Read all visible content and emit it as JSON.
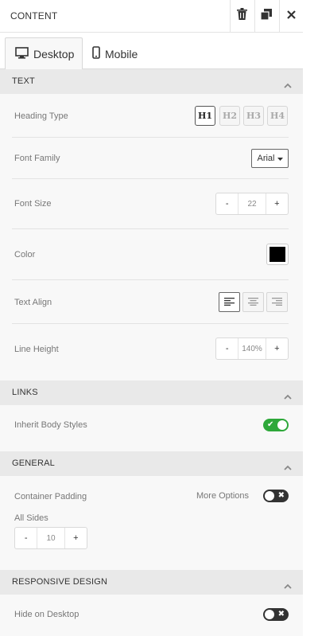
{
  "header": {
    "title": "CONTENT",
    "icons": [
      "trash-icon",
      "copy-icon",
      "close-icon"
    ]
  },
  "tabs": [
    {
      "label": "Desktop",
      "icon": "monitor-icon",
      "active": true
    },
    {
      "label": "Mobile",
      "icon": "phone-icon",
      "active": false
    }
  ],
  "sections": {
    "text": {
      "title": "TEXT",
      "heading_type": {
        "label": "Heading Type",
        "options": [
          "H1",
          "H2",
          "H3",
          "H4"
        ],
        "selected": "H1"
      },
      "font_family": {
        "label": "Font Family",
        "value": "Arial"
      },
      "font_size": {
        "label": "Font Size",
        "value": "22",
        "minus": "-",
        "plus": "+"
      },
      "color": {
        "label": "Color",
        "value": "#000000"
      },
      "text_align": {
        "label": "Text Align",
        "options": [
          "left",
          "center",
          "right"
        ],
        "selected": "left"
      },
      "line_height": {
        "label": "Line Height",
        "value": "140%",
        "minus": "-",
        "plus": "+"
      }
    },
    "links": {
      "title": "LINKS",
      "inherit_body_styles": {
        "label": "Inherit Body Styles",
        "on": true
      }
    },
    "general": {
      "title": "GENERAL",
      "container_padding": {
        "label": "Container Padding",
        "more_options": "More Options",
        "more_options_on": false
      },
      "all_sides": {
        "label": "All Sides",
        "value": "10",
        "minus": "-",
        "plus": "+"
      }
    },
    "responsive": {
      "title": "RESPONSIVE DESIGN",
      "hide_on_desktop": {
        "label": "Hide on Desktop",
        "on": false
      }
    }
  },
  "colors": {
    "toggle_on": "#2ea83a",
    "toggle_off": "#333333",
    "section_header_bg": "#e9e9e9"
  }
}
